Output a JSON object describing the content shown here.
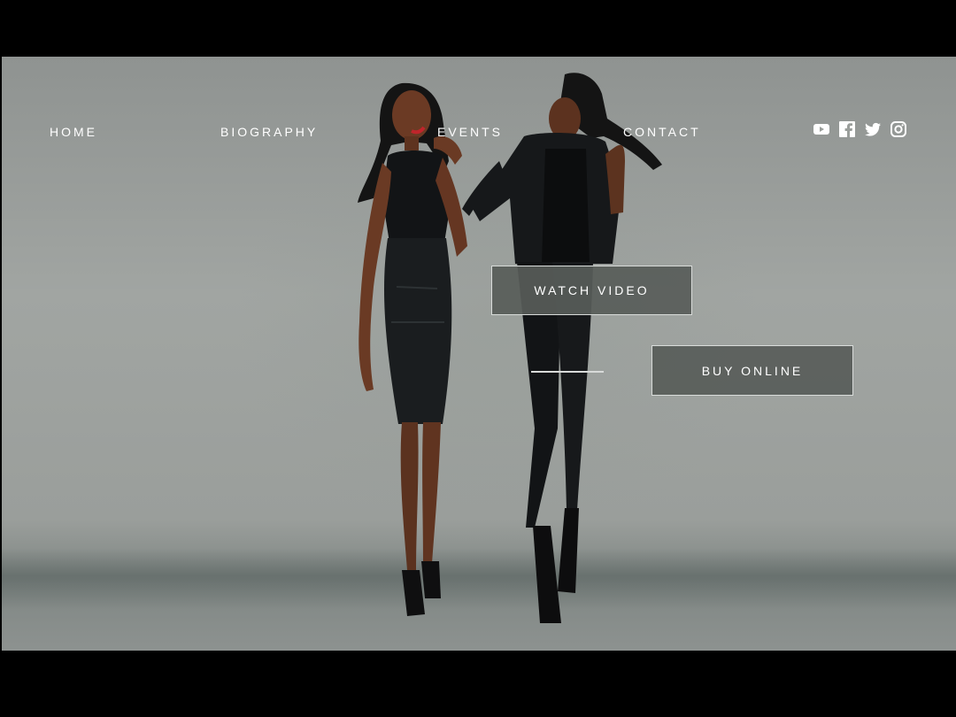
{
  "nav": {
    "items": [
      {
        "label": "HOME"
      },
      {
        "label": "BIOGRAPHY"
      },
      {
        "label": "EVENTS"
      },
      {
        "label": "CONTACT"
      }
    ]
  },
  "social": {
    "icons": [
      "youtube-icon",
      "facebook-icon",
      "twitter-icon",
      "instagram-icon"
    ]
  },
  "hero": {
    "watch_label": "WATCH VIDEO",
    "buy_label": "BUY ONLINE"
  },
  "colors": {
    "background": "#9da19e",
    "button_fill": "#5a5e5b",
    "button_border": "#d9dcda",
    "text": "#ffffff"
  }
}
